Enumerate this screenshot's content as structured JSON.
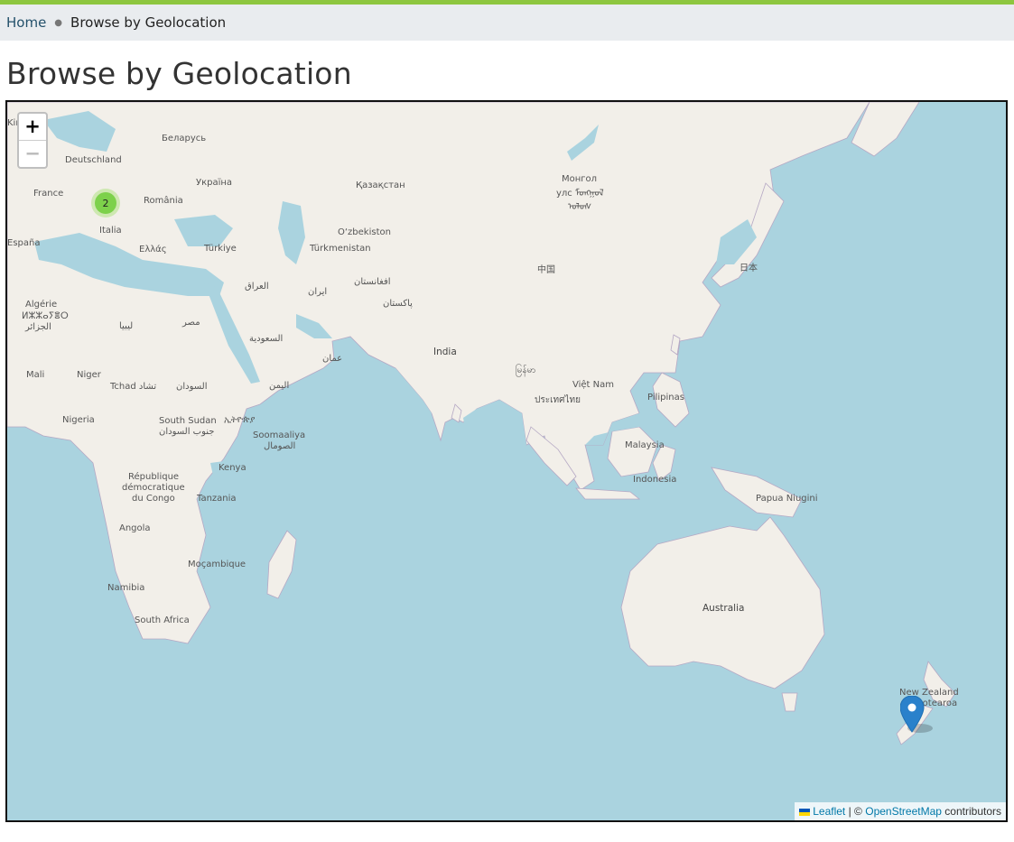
{
  "breadcrumb": {
    "home": "Home",
    "separator": "●",
    "current": "Browse by Geolocation"
  },
  "page_title": "Browse by Geolocation",
  "map": {
    "zoom_in_label": "+",
    "zoom_out_label": "−",
    "cluster_count": "2",
    "marker_location": "New Zealand",
    "labels": {
      "belarus": "Беларусь",
      "deutschland": "Deutschland",
      "ukraina": "Україна",
      "france": "France",
      "romania": "România",
      "italia": "Italia",
      "espana": "España",
      "ellas": "Ελλάς",
      "turkiye": "Türkiye",
      "kazakhstan": "Қазақстан",
      "mongol": "Монгол",
      "mongol_2": "улс ᠮᠣᠩᠭᠣᠯ",
      "mongol_3": "ᠤᠯᠤᠰ",
      "uzbekiston": "O‘zbekiston",
      "turkmenistan": "Türkmenistan",
      "algerie": "Algérie",
      "algerie_2": "ⵍⵣⵣⴰⵢⴻⵔ",
      "algerie_3": "الجزائر",
      "libya": "ليبيا",
      "misr": "مصر",
      "iraq": "العراق",
      "iran": "ایران",
      "afghanistan": "افغانستان",
      "pakistan": "پاکستان",
      "zhongguo": "中国",
      "nihon": "日本",
      "saudi": "السعودية",
      "oman": "عمان",
      "yemen": "اليمن",
      "india": "India",
      "myanmar": "မြန်မာ",
      "thailand": "ประเทศไทย",
      "vietnam": "Việt Nam",
      "pilipinas": "Pilipinas",
      "mali": "Mali",
      "niger": "Niger",
      "tchad": "Tchad تشاد",
      "sudan": "السودان",
      "nigeria": "Nigeria",
      "south_sudan": "South Sudan",
      "south_sudan_2": "جنوب السودان",
      "ethiopia": "ኢትዮጵያ",
      "somalia": "Soomaaliya",
      "somalia_2": "الصومال",
      "malaysia": "Malaysia",
      "indonesia": "Indonesia",
      "png": "Papua Niugini",
      "rdc": "République",
      "rdc_2": "démocratique",
      "rdc_3": "du Congo",
      "kenya": "Kenya",
      "tanzania": "Tanzania",
      "angola": "Angola",
      "mocambique": "Moçambique",
      "namibia": "Namibia",
      "south_africa": "South Africa",
      "australia": "Australia",
      "nz": "New Zealand",
      "nz_2": "Aotearoa",
      "kingdom_fragment": "Kingdom"
    },
    "attribution": {
      "leaflet": "Leaflet",
      "sep": "| ©",
      "osm": "OpenStreetMap",
      "contributors": "contributors"
    }
  },
  "colors": {
    "accent_bar": "#8dc63f",
    "water": "#aad3df",
    "land": "#f2efe9",
    "link": "#24516b",
    "cluster": "#6ecc39",
    "marker": "#2a81cb"
  }
}
